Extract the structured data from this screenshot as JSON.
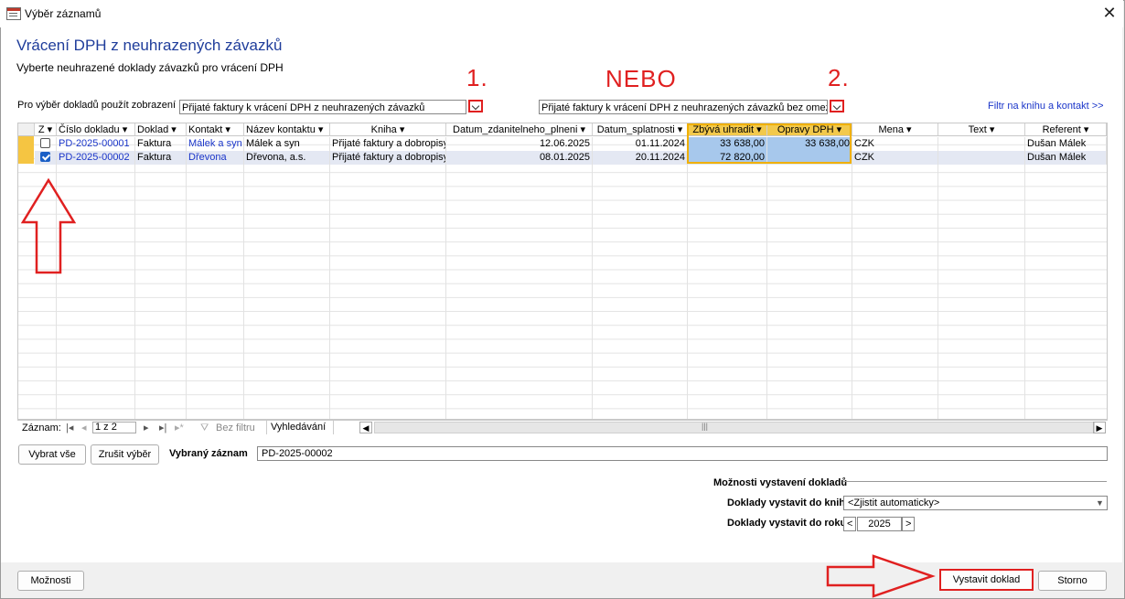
{
  "window": {
    "title": "Výběr záznamů"
  },
  "header": {
    "title": "Vrácení DPH z neuhrazených závazků",
    "subtitle": "Vyberte neuhrazené doklady závazků pro vrácení DPH"
  },
  "annotations": {
    "one": "1.",
    "or": "NEBO",
    "two": "2."
  },
  "view_selector": {
    "label": "Pro výběr dokladů použít zobrazení",
    "combo1_value": "Přijaté faktury k vrácení DPH z neuhrazených závazků",
    "combo2_value": "Přijaté faktury k vrácení DPH z neuhrazených závazků bez omezení",
    "filter_link": "Filtr na knihu a kontakt >>"
  },
  "grid": {
    "columns": [
      "Číslo dokladu",
      "Doklad",
      "Kontakt",
      "Název kontaktu",
      "Kniha",
      "Datum_zdanitelneho_plneni",
      "Datum_splatnosti",
      "Zbývá uhradit",
      "Opravy DPH",
      "Mena",
      "Text",
      "Referent"
    ],
    "first_col": "Z",
    "rows": [
      {
        "checked": false,
        "cislo": "PD-2025-00001",
        "doklad": "Faktura",
        "kontakt": "Málek a syn",
        "nazev": "Málek a syn",
        "kniha": "Přijaté faktury a dobropisy",
        "dzp": "12.06.2025",
        "ds": "01.11.2024",
        "zbyva": "33 638,00",
        "opravy": "33 638,00",
        "mena": "CZK",
        "text": "",
        "referent": "Dušan Málek"
      },
      {
        "checked": true,
        "cislo": "PD-2025-00002",
        "doklad": "Faktura",
        "kontakt": "Dřevona",
        "nazev": "Dřevona, a.s.",
        "kniha": "Přijaté faktury a dobropisy",
        "dzp": "08.01.2025",
        "ds": "20.11.2024",
        "zbyva": "72 820,00",
        "opravy": "",
        "mena": "CZK",
        "text": "",
        "referent": "Dušan Málek"
      }
    ]
  },
  "navigation": {
    "label": "Záznam:",
    "position": "1 z 2",
    "filter": "Bez filtru",
    "search": "Vyhledávání"
  },
  "selection": {
    "select_all": "Vybrat vše",
    "clear": "Zrušit výběr",
    "selected_label": "Vybraný záznam",
    "selected_value": "PD-2025-00002"
  },
  "options": {
    "section_title": "Možnosti vystavení dokladů",
    "book_label": "Doklady vystavit do knihy",
    "book_value": "<Zjistit automaticky>",
    "year_label": "Doklady vystavit do roku",
    "year_value": "2025",
    "prev": "<",
    "next": ">"
  },
  "footer": {
    "options_button": "Možnosti",
    "create_button": "Vystavit doklad",
    "cancel_button": "Storno"
  },
  "colors": {
    "accent_blue": "#1f3d9b",
    "annotation_red": "#e02020",
    "highlight_orange": "#f0b000",
    "highlight_cell": "#a7c8ec",
    "selector": "#f5c542"
  }
}
